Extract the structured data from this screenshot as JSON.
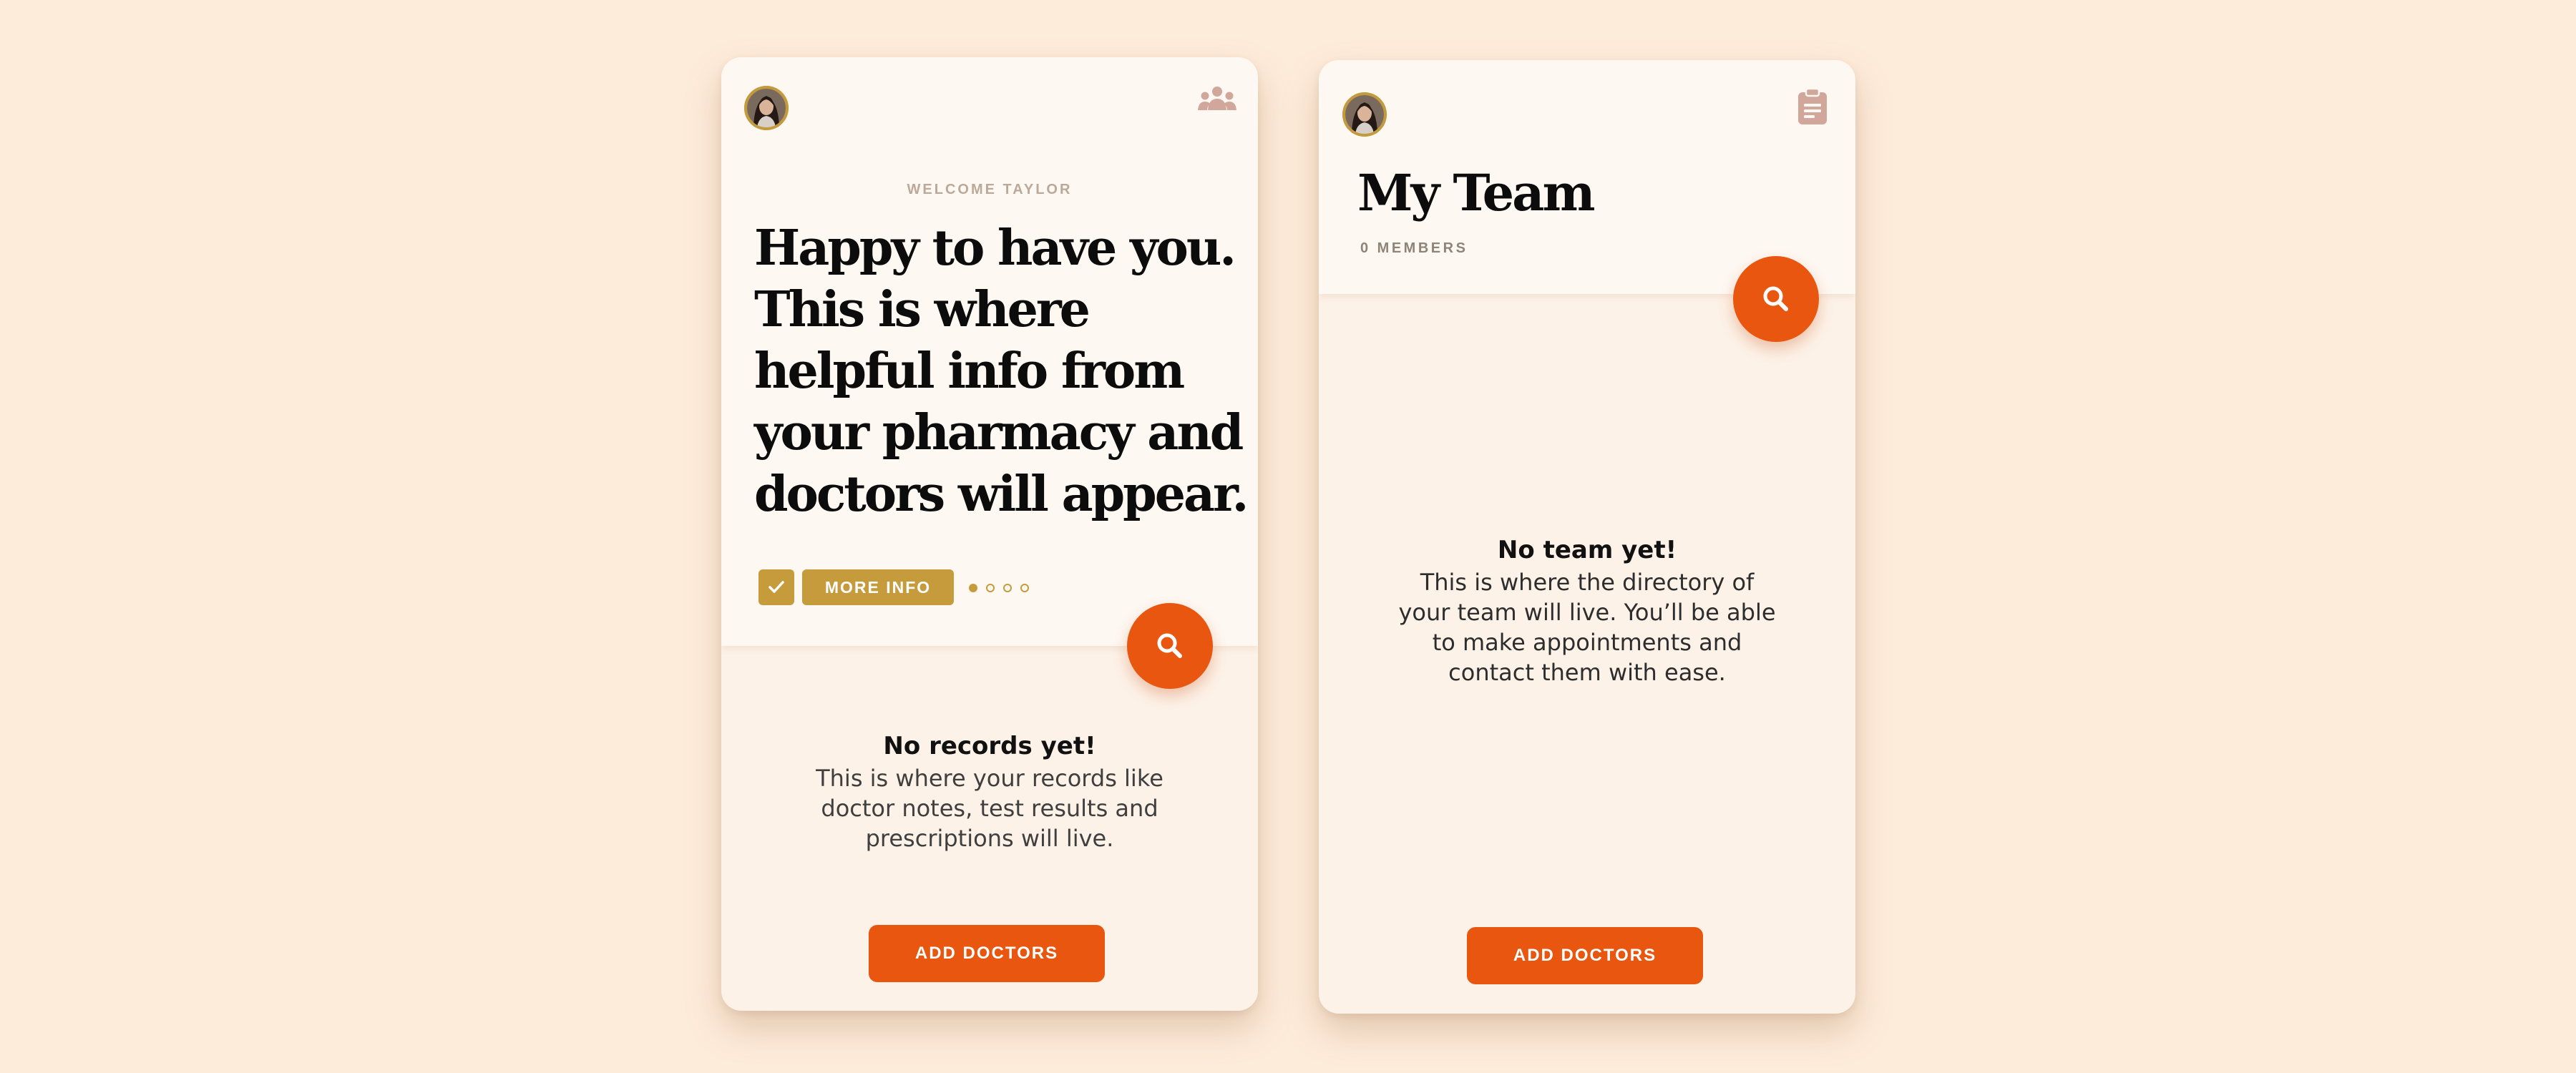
{
  "colors": {
    "background": "#feecda",
    "card": "#fdf2e8",
    "card_header": "#fef8f2",
    "accent_orange": "#e8560f",
    "accent_gold": "#c69b3c",
    "icon_muted": "#d1a69b"
  },
  "home_card": {
    "avatar_icon": "user-avatar-icon",
    "corner_icon": "team-icon",
    "welcome": "WELCOME TAYLOR",
    "hero": "Happy to have you. This is where helpful info from your pharmacy and doctors will appear.",
    "check_icon": "check-icon",
    "more_info_label": "MORE INFO",
    "pager_total": 4,
    "pager_active": 1,
    "search_icon": "search-icon",
    "empty_title": "No records yet!",
    "empty_text": "This is where your records like doctor notes, test results and prescriptions will live.",
    "add_button_label": "ADD DOCTORS"
  },
  "team_card": {
    "avatar_icon": "user-avatar-icon",
    "corner_icon": "clipboard-icon",
    "title": "My Team",
    "members": "0 MEMBERS",
    "search_icon": "search-icon",
    "empty_title": "No team yet!",
    "empty_text": "This is where the directory of your team will live. You’ll be able to make appointments and contact them with ease.",
    "add_button_label": "ADD DOCTORS"
  }
}
